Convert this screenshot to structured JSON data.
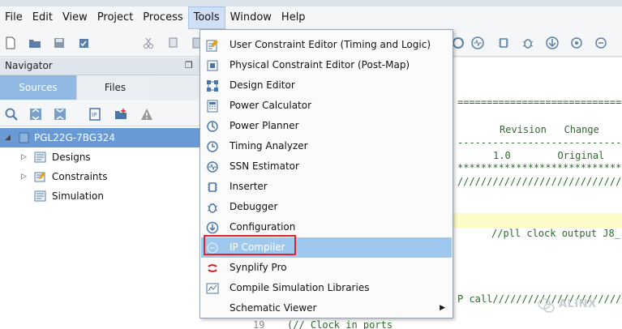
{
  "menubar": {
    "items": [
      "File",
      "Edit",
      "View",
      "Project",
      "Process",
      "Tools",
      "Window",
      "Help"
    ],
    "active": "Tools"
  },
  "navigator": {
    "title": "Navigator",
    "tabs": [
      "Sources",
      "Files"
    ],
    "active_tab": "Sources",
    "tree": [
      {
        "label": "PGL22G-7BG324",
        "selected": true,
        "expandable": true
      },
      {
        "label": "Designs",
        "expandable": true
      },
      {
        "label": "Constraints",
        "expandable": true
      },
      {
        "label": "Simulation",
        "expandable": false
      }
    ]
  },
  "tools_menu": {
    "items": [
      {
        "label": "User Constraint Editor (Timing and Logic)",
        "icon": "constraint-editor-icon"
      },
      {
        "label": "Physical Constraint Editor (Post-Map)",
        "icon": "physical-constraint-icon"
      },
      {
        "label": "Design Editor",
        "icon": "design-editor-icon"
      },
      {
        "label": "Power Calculator",
        "icon": "calculator-icon"
      },
      {
        "label": "Power Planner",
        "icon": "power-planner-icon"
      },
      {
        "label": "Timing Analyzer",
        "icon": "timing-icon"
      },
      {
        "label": "SSN Estimator",
        "icon": "ssn-icon"
      },
      {
        "label": "Inserter",
        "icon": "inserter-icon"
      },
      {
        "label": "Debugger",
        "icon": "debugger-icon"
      },
      {
        "label": "Configuration",
        "icon": "configuration-icon"
      },
      {
        "label": "IP Compiler",
        "icon": "ip-compiler-icon",
        "highlighted": true
      },
      {
        "label": "Synplify Pro",
        "icon": "synplify-icon"
      },
      {
        "label": "Compile Simulation Libraries",
        "icon": "sim-lib-icon"
      },
      {
        "label": "Schematic Viewer",
        "icon": "",
        "submenu": true
      }
    ]
  },
  "editor": {
    "lines": [
      {
        "text": "===========================================",
        "color": "#2a6b2a"
      },
      {
        "text": "Revision   Change",
        "color": "#2a6b2a"
      },
      {
        "text": "-------------------------------------------",
        "color": "#2a6b2a"
      },
      {
        "text": "1.0        Original",
        "color": "#2a6b2a"
      },
      {
        "text": "******************************************",
        "color": "#2a6b2a"
      },
      {
        "text": "/////////////////////////////////////////",
        "color": "#2a6b2a"
      },
      {
        "text": "//pll clock output J8_",
        "color": "#2a6b2a"
      },
      {
        "text": "P call//////////////////////////////",
        "color": "#2a6b2a"
      },
      {
        "text": "(// Clock in ports",
        "color": "#2a6b2a"
      }
    ],
    "line_number": "19"
  },
  "watermark": "ALINX",
  "colors": {
    "selection": "#6a9ad6",
    "menu_hover": "#9ec8ee",
    "redbox": "#e0232f",
    "code": "#2a6b2a"
  }
}
